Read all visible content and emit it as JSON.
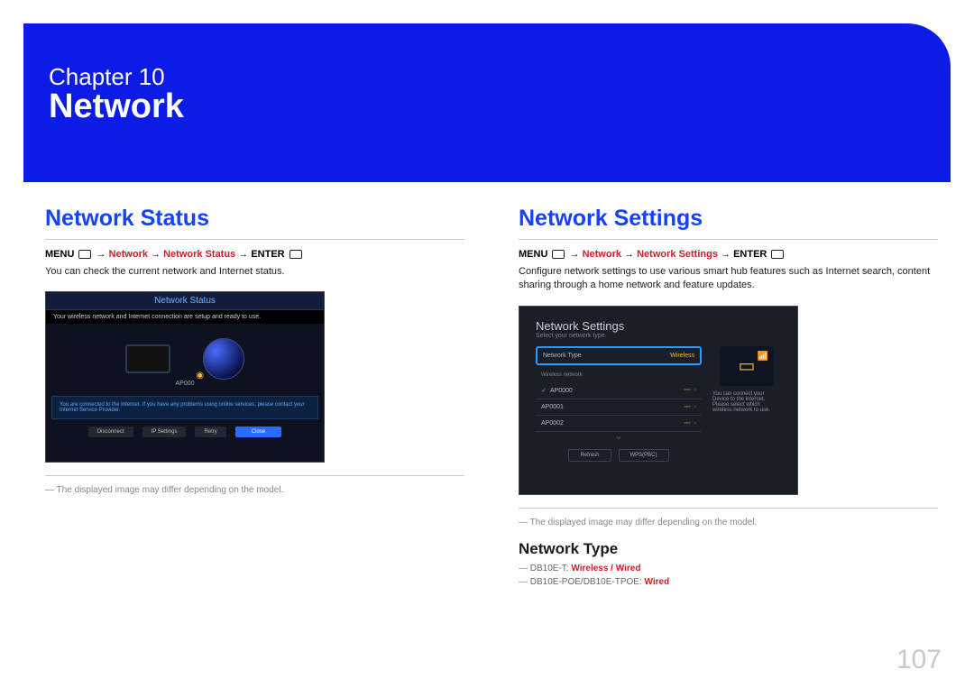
{
  "banner": {
    "chapter_label": "Chapter 10",
    "chapter_title": "Network"
  },
  "page_number": "107",
  "left": {
    "heading": "Network Status",
    "nav": {
      "menu": "MENU",
      "arrow": "→",
      "p1": "Network",
      "p2": "Network Status",
      "enter": "ENTER"
    },
    "body": "You can check the current network and Internet status.",
    "mock": {
      "title": "Network Status",
      "line1": "Your wireless network and Internet connection are setup and ready to use.",
      "ap": "AP000",
      "line2": "You are connected to the Internet. If you have any problems using online services, please contact your Internet Service Provider.",
      "buttons": [
        "Disconnect",
        "IP Settings",
        "Retry",
        "Close"
      ]
    },
    "caption": "The displayed image may differ depending on the model."
  },
  "right": {
    "heading": "Network Settings",
    "nav": {
      "menu": "MENU",
      "arrow": "→",
      "p1": "Network",
      "p2": "Network Settings",
      "enter": "ENTER"
    },
    "body": "Configure network settings to use various smart hub features such as Internet search, content sharing through a home network and feature updates.",
    "mock": {
      "title": "Network Settings",
      "subtitle": "Select your network type.",
      "type_row": {
        "label": "Network Type",
        "value": "Wireless"
      },
      "section": "Wireless network",
      "aps": [
        "AP0000",
        "AP0001",
        "AP0002"
      ],
      "side_text": "You can connect your Device to the internet. Please select which wireless network to use.",
      "buttons": [
        "Refresh",
        "WPS(PBC)"
      ]
    },
    "caption": "The displayed image may differ depending on the model.",
    "subheading": "Network Type",
    "models": [
      {
        "prefix": "DB10E-T: ",
        "opts": "Wireless / Wired"
      },
      {
        "prefix": "DB10E-POE/DB10E-TPOE: ",
        "opts": "Wired"
      }
    ]
  }
}
